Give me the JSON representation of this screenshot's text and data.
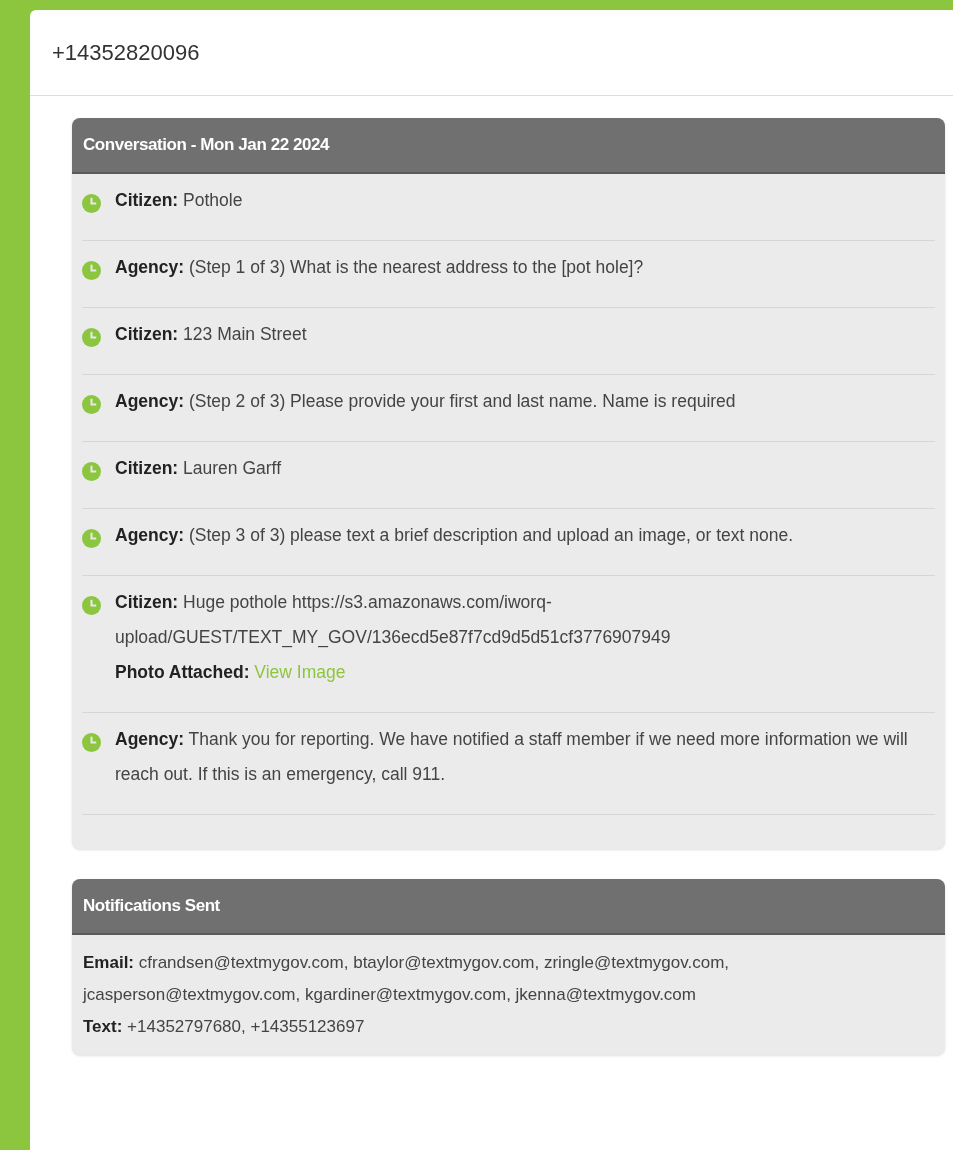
{
  "dialog": {
    "title": "+14352820096"
  },
  "conversation": {
    "title": "Conversation - Mon Jan 22 2024",
    "messages": [
      {
        "speaker": "Citizen:",
        "text": "Pothole"
      },
      {
        "speaker": "Agency:",
        "text": "(Step 1 of 3) What is the nearest address to the [pot hole]?"
      },
      {
        "speaker": "Citizen:",
        "text": "123 Main Street"
      },
      {
        "speaker": "Agency:",
        "text": "(Step 2 of 3) Please provide your first and last name. Name is required"
      },
      {
        "speaker": "Citizen:",
        "text": "Lauren Garff"
      },
      {
        "speaker": "Agency:",
        "text": "(Step 3 of 3) please text a brief description and upload an image, or text none."
      },
      {
        "speaker": "Citizen:",
        "text": "Huge pothole https://s3.amazonaws.com/iworq-upload/GUEST/TEXT_MY_GOV/136ecd5e87f7cd9d5d51cf3776907949",
        "attachment": {
          "label": "Photo Attached:",
          "link": "View Image"
        }
      },
      {
        "speaker": "Agency:",
        "text": "Thank you for reporting. We have notified a staff member if we need more information we will reach out. If this is an emergency, call 911."
      }
    ]
  },
  "notifications": {
    "title": "Notifications Sent",
    "lines": [
      {
        "label": "Email:",
        "text": "cfrandsen@textmygov.com, btaylor@textmygov.com, zringle@textmygov.com, jcasperson@textmygov.com, kgardiner@textmygov.com, jkenna@textmygov.com"
      },
      {
        "label": "Text:",
        "text": "+14352797680, +14355123697"
      }
    ]
  }
}
